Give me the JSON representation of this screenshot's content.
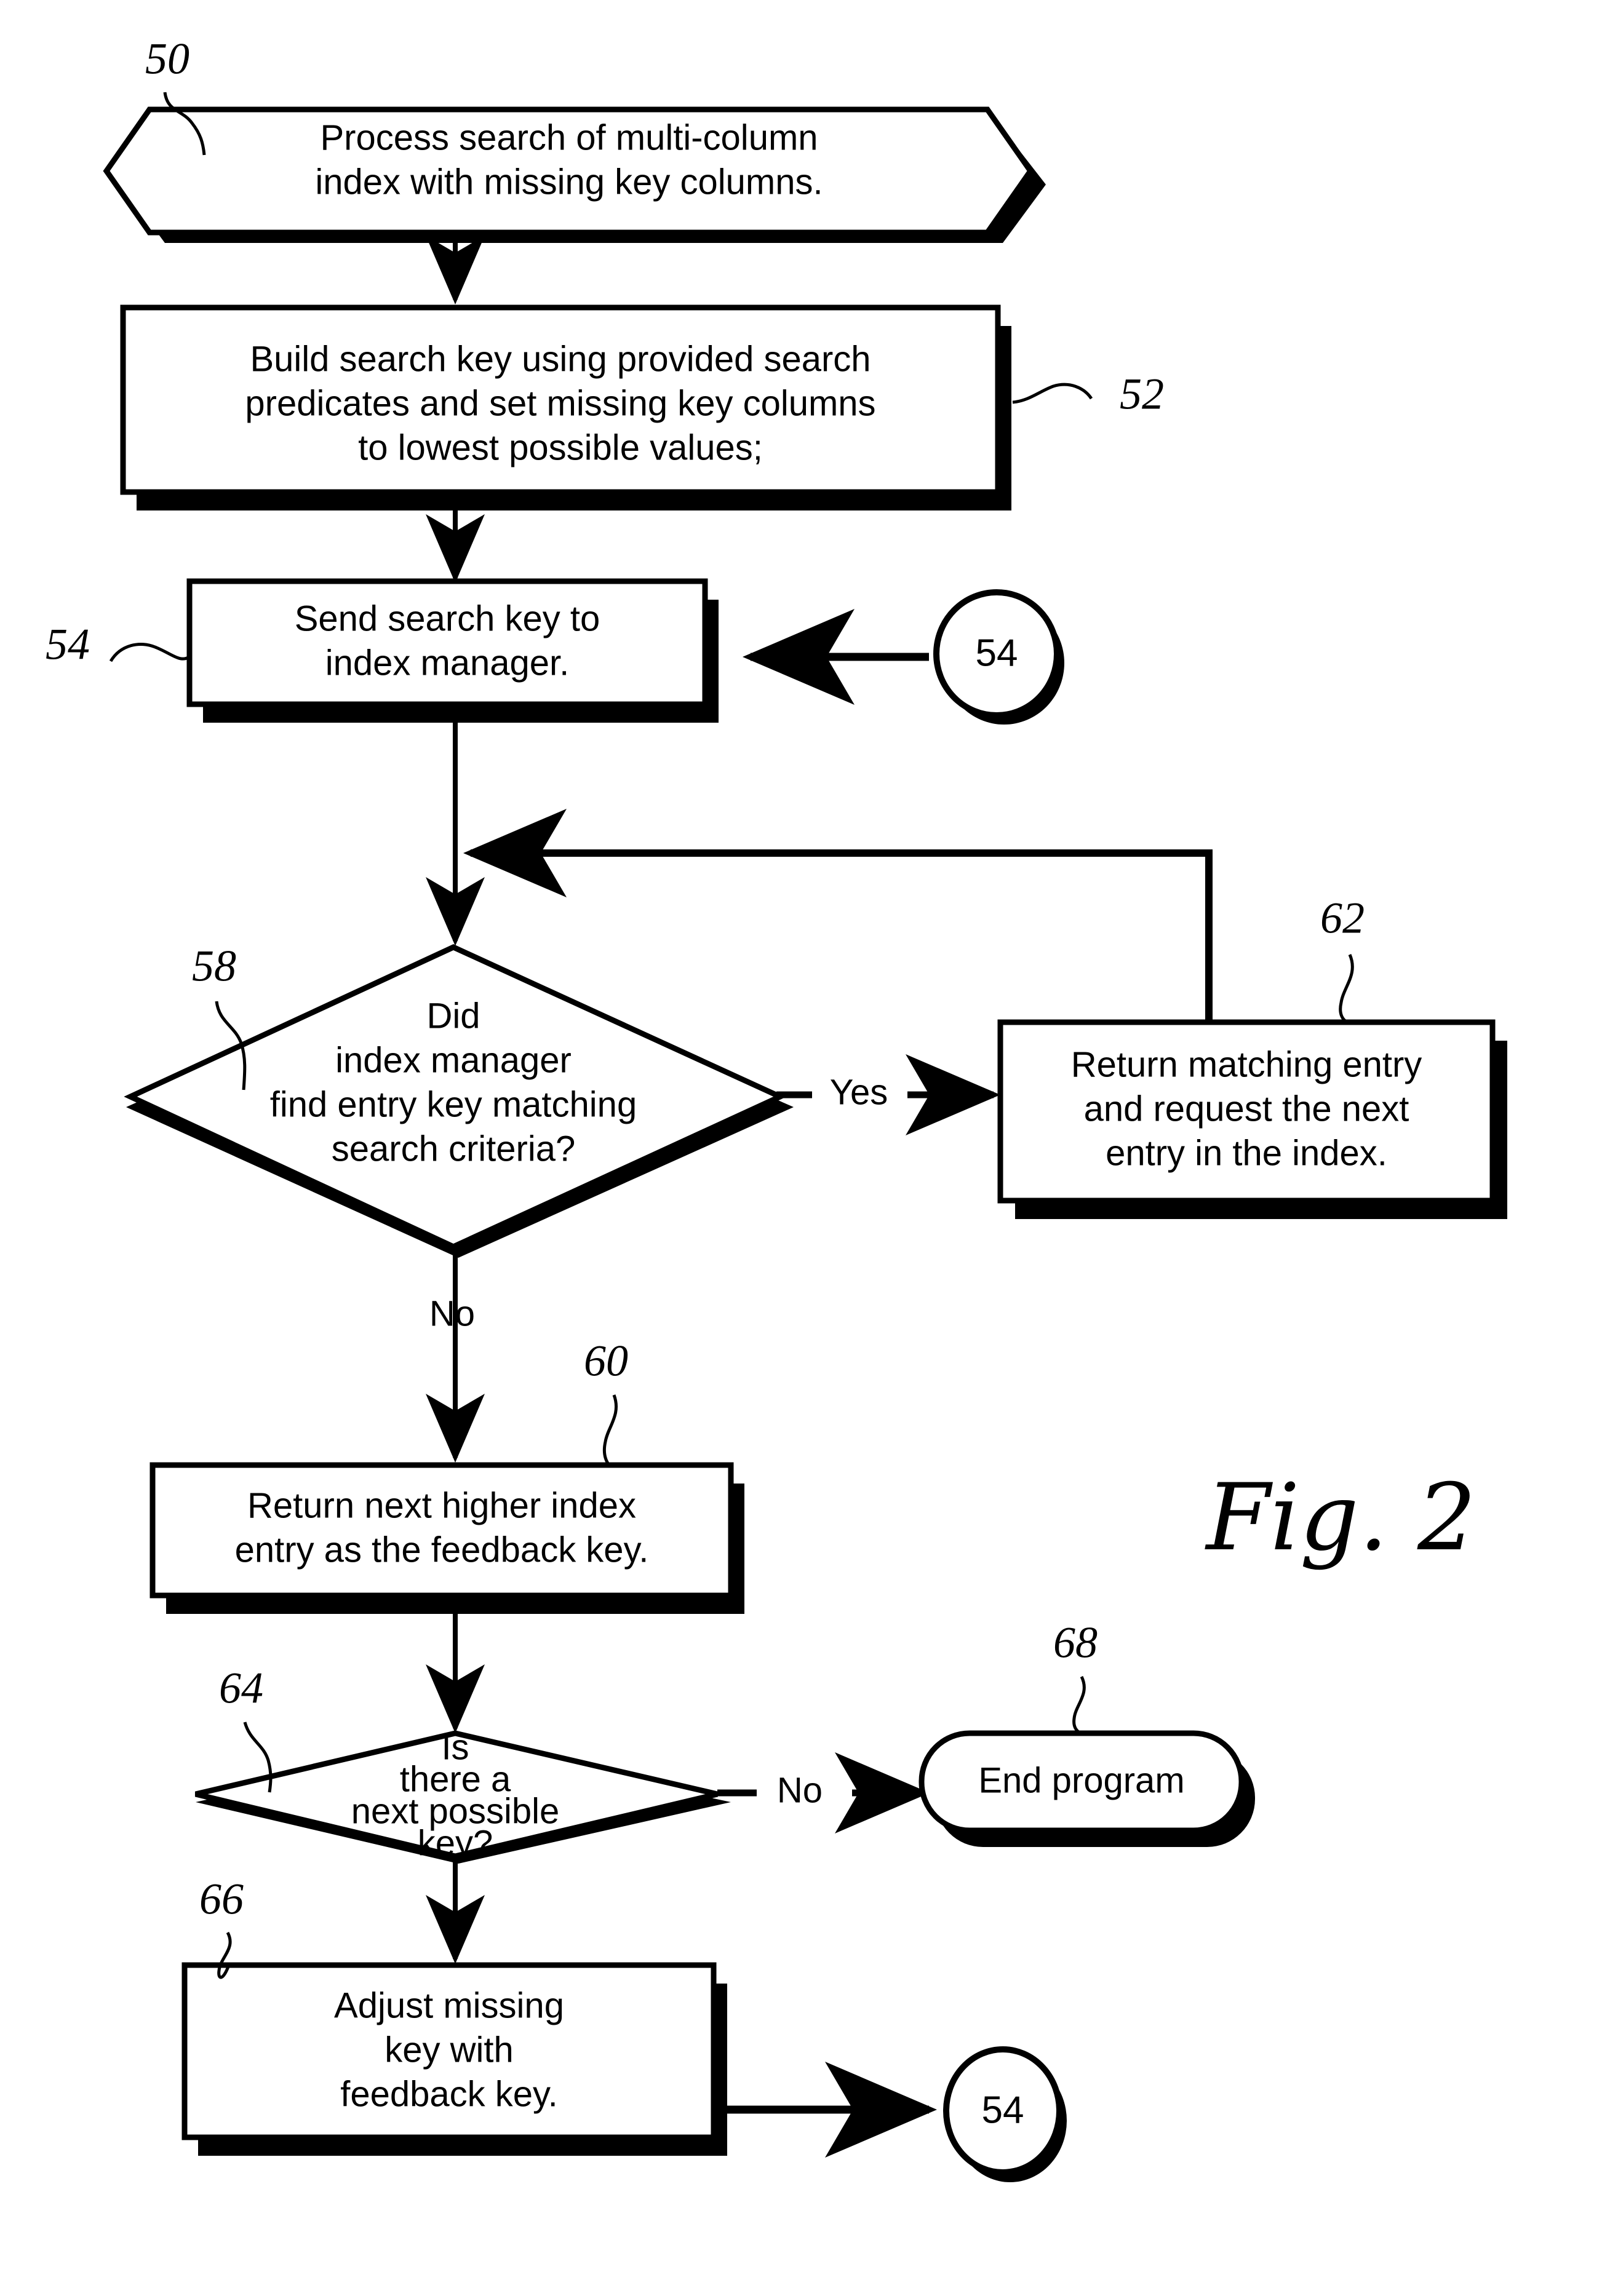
{
  "figure": {
    "label": "Fig. 2",
    "colors": {
      "ink": "#000000",
      "paper": "#ffffff"
    }
  },
  "nodes": [
    {
      "id": "50",
      "ref": "50",
      "shape": "hexagon",
      "kind": "terminator",
      "lines": [
        "Process search of multi-column",
        "index with missing key columns."
      ]
    },
    {
      "id": "52",
      "ref": "52",
      "shape": "rect",
      "kind": "process",
      "lines": [
        "Build search key using provided search",
        "predicates and set missing key columns",
        "to lowest possible values;"
      ]
    },
    {
      "id": "54",
      "ref": "54",
      "shape": "rect",
      "kind": "process",
      "lines": [
        "Send search key to",
        "index manager."
      ]
    },
    {
      "id": "58",
      "ref": "58",
      "shape": "diamond",
      "kind": "decision",
      "lines": [
        "Did",
        "index manager",
        "find entry key matching",
        "search criteria?"
      ]
    },
    {
      "id": "62",
      "ref": "62",
      "shape": "rect",
      "kind": "process",
      "lines": [
        "Return matching entry",
        "and request the next",
        "entry in the index."
      ]
    },
    {
      "id": "60",
      "ref": "60",
      "shape": "rect",
      "kind": "process",
      "lines": [
        "Return next higher index",
        "entry as the feedback key."
      ]
    },
    {
      "id": "64",
      "ref": "64",
      "shape": "diamond",
      "kind": "decision",
      "lines": [
        "Is",
        "there a",
        "next possible",
        "key?"
      ]
    },
    {
      "id": "68",
      "ref": "68",
      "shape": "stadium",
      "kind": "terminator",
      "lines": [
        "End program"
      ]
    },
    {
      "id": "66",
      "ref": "66",
      "shape": "rect",
      "kind": "process",
      "lines": [
        "Adjust missing",
        "key with",
        "feedback key."
      ]
    }
  ],
  "connectors": [
    {
      "id": "conn-54-top",
      "shape": "circle",
      "label": "54"
    },
    {
      "id": "conn-54-bottom",
      "shape": "circle",
      "label": "54"
    }
  ],
  "edge_labels": {
    "yes_from_58": "Yes",
    "no_from_58": "No",
    "no_from_64": "No"
  }
}
